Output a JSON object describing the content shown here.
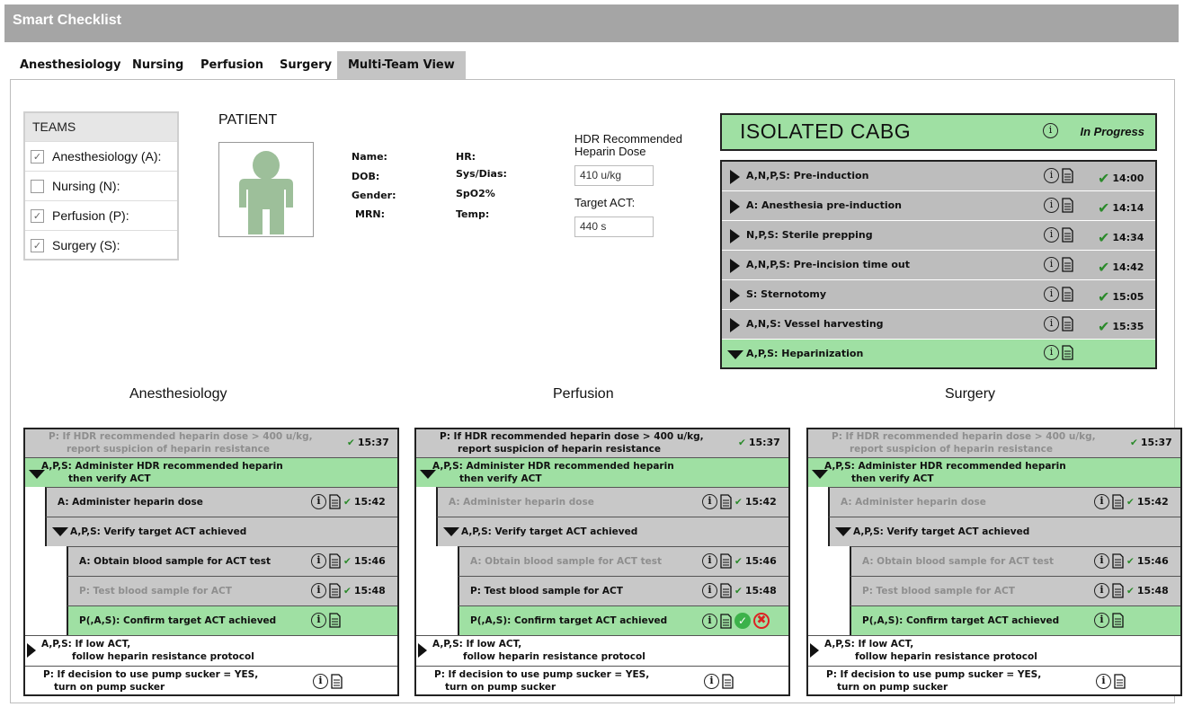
{
  "app_title": "Smart Checklist",
  "tabs": [
    "Anesthesiology",
    "Nursing",
    "Perfusion",
    "Surgery",
    "Multi-Team View"
  ],
  "active_tab": "Multi-Team View",
  "teams": {
    "header": "TEAMS",
    "items": [
      {
        "label": "Anesthesiology (A):",
        "checked": true
      },
      {
        "label": "Nursing (N):",
        "checked": false
      },
      {
        "label": "Perfusion (P):",
        "checked": true
      },
      {
        "label": "Surgery (S):",
        "checked": true
      }
    ]
  },
  "patient": {
    "title": "PATIENT",
    "labels_left": [
      "Name:",
      "DOB:",
      "Gender:",
      "MRN:"
    ],
    "labels_right": [
      "HR:",
      "Sys/Dias:",
      "SpO2%",
      "Temp:"
    ]
  },
  "hdr": {
    "dose_label_line1": "HDR Recommended",
    "dose_label_line2": "Heparin Dose",
    "dose_value": "410 u/kg",
    "act_label": "Target ACT:",
    "act_value": "440 s"
  },
  "case": {
    "title": "ISOLATED CABG",
    "status": "In Progress"
  },
  "steps": [
    {
      "label": "A,N,P,S: Pre-induction",
      "time": "14:00",
      "expanded": false
    },
    {
      "label": "A: Anesthesia pre-induction",
      "time": "14:14",
      "expanded": false
    },
    {
      "label": "N,P,S: Sterile prepping",
      "time": "14:34",
      "expanded": false
    },
    {
      "label": "A,N,P,S: Pre-incision time out",
      "time": "14:42",
      "expanded": false
    },
    {
      "label": "S: Sternotomy",
      "time": "15:05",
      "expanded": false
    },
    {
      "label": "A,N,S: Vessel harvesting",
      "time": "15:35",
      "expanded": false
    },
    {
      "label": "A,P,S: Heparinization",
      "time": "",
      "expanded": true
    }
  ],
  "columns": [
    {
      "title": "Anesthesiology",
      "rows": {
        "r1a": "P: If HDR recommended heparin dose > 400 u/kg,",
        "r1b": "report suspicion of heparin resistance",
        "r1t": "15:37",
        "r2a": "A,P,S: Administer HDR recommended heparin",
        "r2b": "then verify ACT",
        "r3": "A: Administer heparin dose",
        "r3t": "15:42",
        "r4": "A,P,S: Verify target ACT achieved",
        "r5": "A: Obtain blood sample for ACT test",
        "r5t": "15:46",
        "r6": "P: Test blood sample for ACT",
        "r6t": "15:48",
        "r7": "P(,A,S): Confirm target ACT achieved",
        "r8a": "A,P,S: If low ACT,",
        "r8b": "follow heparin resistance protocol",
        "r9a": "P: If decision to use pump sucker = YES,",
        "r9b": "turn on pump sucker"
      }
    },
    {
      "title": "Perfusion",
      "rows": {
        "r1a": "P: If HDR recommended heparin dose > 400 u/kg,",
        "r1b": "report suspicion of heparin resistance",
        "r1t": "15:37",
        "r2a": "A,P,S: Administer HDR recommended heparin",
        "r2b": "then verify ACT",
        "r3": "A: Administer heparin dose",
        "r3t": "15:42",
        "r4": "A,P,S: Verify target ACT achieved",
        "r5": "A: Obtain blood sample for ACT test",
        "r5t": "15:46",
        "r6": "P: Test blood sample for ACT",
        "r6t": "15:48",
        "r7": "P(,A,S): Confirm target ACT achieved",
        "r8a": "A,P,S: If low ACT,",
        "r8b": "follow heparin resistance protocol",
        "r9a": "P: If decision to use pump sucker = YES,",
        "r9b": "turn on pump sucker"
      }
    },
    {
      "title": "Surgery",
      "rows": {
        "r1a": "P: If HDR recommended heparin dose > 400 u/kg,",
        "r1b": "report suspicion of heparin resistance",
        "r1t": "15:37",
        "r2a": "A,P,S: Administer HDR recommended heparin",
        "r2b": "then verify ACT",
        "r3": "A: Administer heparin dose",
        "r3t": "15:42",
        "r4": "A,P,S: Verify target ACT achieved",
        "r5": "A: Obtain blood sample for ACT test",
        "r5t": "15:46",
        "r6": "P: Test blood sample for ACT",
        "r6t": "15:48",
        "r7": "P(,A,S): Confirm target ACT achieved",
        "r8a": "A,P,S: If low ACT,",
        "r8b": "follow heparin resistance protocol",
        "r9a": "P: If decision to use pump sucker = YES,",
        "r9b": "turn on pump sucker"
      }
    }
  ],
  "icon_names": {
    "info": "info-circle-icon",
    "doc": "document-icon",
    "check": "checkmark-icon"
  },
  "colors": {
    "title_bar": "#a5a5a5",
    "active_green": "#9fe0a3",
    "done_gray": "#bdbdbd",
    "check_green": "#2a8a2a",
    "reject_red": "#d22222"
  },
  "glyphs": {
    "info": "i",
    "check": "✔",
    "box_check": "✓",
    "confirm": "✓",
    "reject": "✖"
  }
}
